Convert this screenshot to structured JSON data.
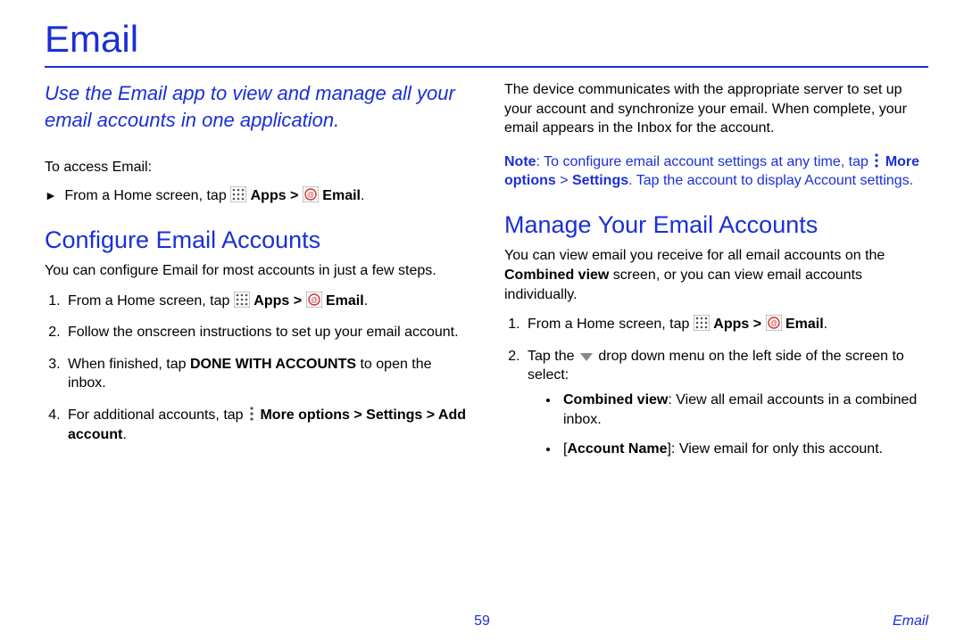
{
  "title": "Email",
  "intro": "Use the Email app to view and manage all your email accounts in one application.",
  "access_label": "To access Email:",
  "access_step_prefix": "From a Home screen, tap ",
  "apps_label": "Apps",
  "email_label": "Email",
  "sep": " > ",
  "configure": {
    "heading": "Configure Email Accounts",
    "desc": "You can configure Email for most accounts in just a few steps.",
    "steps": {
      "s1_prefix": "From a Home screen, tap ",
      "s2": "Follow the onscreen instructions to set up your email account.",
      "s3_a": "When finished, tap ",
      "s3_b": "DONE WITH ACCOUNTS",
      "s3_c": " to open the inbox.",
      "s4_a": "For additional accounts, tap ",
      "s4_b": "More options",
      "s4_c": "Settings",
      "s4_d": "Add account"
    }
  },
  "right": {
    "p1": "The device communicates with the appropriate server to set up your account and synchronize your email. When complete, your email appears in the Inbox for the account.",
    "note_label": "Note",
    "note_a": ": To configure email account settings at any time, tap ",
    "note_b": "More options",
    "note_c": "Settings",
    "note_d": ". Tap the account to display Account settings."
  },
  "manage": {
    "heading": "Manage Your Email Accounts",
    "desc_a": "You can view email you receive for all email accounts on the ",
    "desc_b": "Combined view",
    "desc_c": " screen, or you can view email accounts individually.",
    "s1_prefix": "From a Home screen, tap ",
    "s2_a": "Tap the ",
    "s2_b": " drop down menu on the left side of the screen to select:",
    "b1_a": "Combined view",
    "b1_b": ": View all email accounts in a combined inbox.",
    "b2_a": "[",
    "b2_b": "Account Name",
    "b2_c": "]: View email for only this account."
  },
  "page_number": "59",
  "footer_section": "Email"
}
